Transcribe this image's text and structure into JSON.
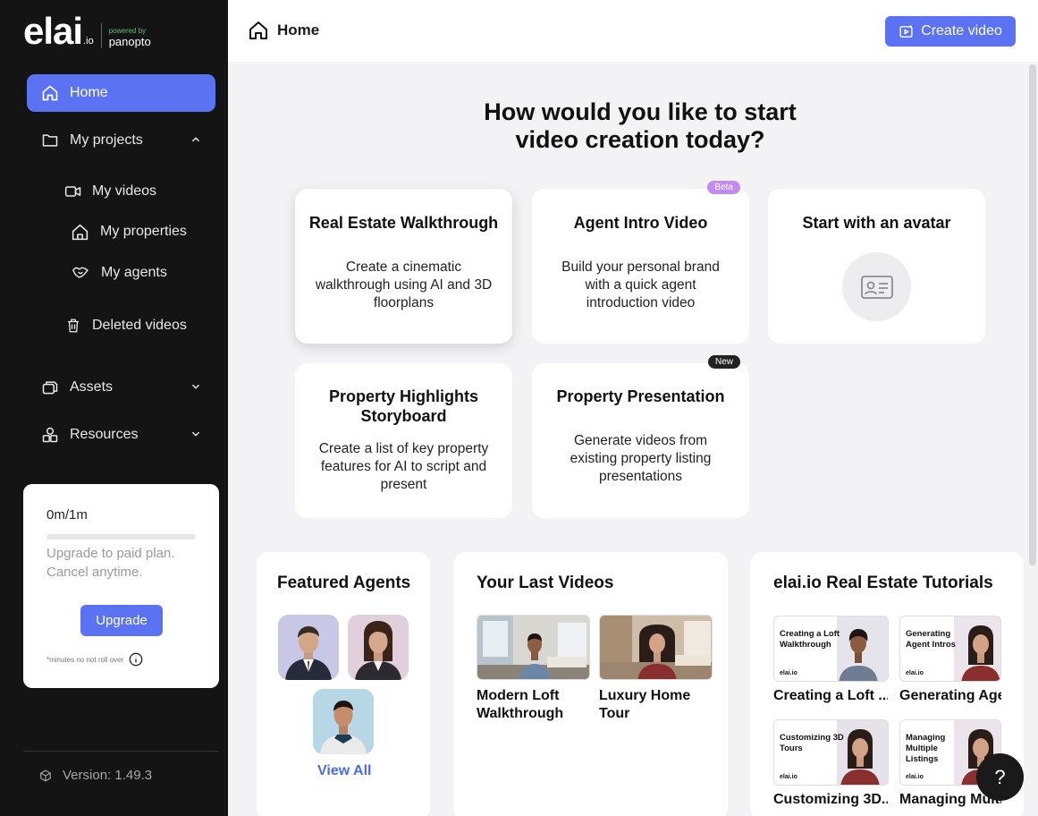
{
  "brand": {
    "logo_main": "elai",
    "logo_io": ".io",
    "powered_by": "powered by",
    "partner": "panopto"
  },
  "sidebar": {
    "home": "Home",
    "my_projects": "My projects",
    "my_videos": "My videos",
    "my_properties": "My properties",
    "my_agents": "My agents",
    "deleted_videos": "Deleted videos",
    "assets": "Assets",
    "resources": "Resources",
    "plan": {
      "usage": "0m/1m",
      "usage_fraction": 0,
      "message": "Upgrade to paid plan. Cancel anytime.",
      "upgrade_label": "Upgrade",
      "note": "*minutes no not roll over"
    },
    "version": "Version: 1.49.3"
  },
  "header": {
    "title": "Home",
    "create_label": "Create video"
  },
  "main": {
    "title": "How would you like to start video creation today?",
    "options": [
      {
        "title": "Real Estate Walkthrough",
        "desc": "Create a cinematic walkthrough using AI and 3D floorplans"
      },
      {
        "title": "Agent Intro Video",
        "desc": "Build your personal brand with a quick agent introduction video",
        "badge": "Beta"
      },
      {
        "title": "Start with an avatar"
      },
      {
        "title": "Property Highlights Storyboard",
        "desc": "Create a list of key property features for AI to script and present"
      },
      {
        "title": "Property Presentation",
        "desc": "Generate videos from existing property listing presentations",
        "badge": "New"
      }
    ]
  },
  "featured_agents": {
    "title": "Featured Agents",
    "view_all": "View All"
  },
  "last_videos": {
    "title": "Your Last Videos",
    "items": [
      {
        "label": "Modern Loft Walkthrough"
      },
      {
        "label": "Luxury Home Tour"
      }
    ]
  },
  "tutorials": {
    "title": "elai.io Real Estate Tutorials",
    "thumb_logo": "elai.io",
    "items": [
      {
        "thumb_text": "Creating a Loft Walkthrough",
        "label": "Creating a Loft ..."
      },
      {
        "thumb_text": "Generating Agent Intros",
        "label": "Generating Age"
      },
      {
        "thumb_text": "Customizing 3D Tours",
        "label": "Customizing 3D..."
      },
      {
        "thumb_text": "Managing Multiple Listings",
        "label": "Managing Multi"
      }
    ]
  },
  "help": {
    "label": "?"
  },
  "colors": {
    "accent": "#5b72f2",
    "sidebar_bg": "#141414",
    "beta_badge": "#c38bf0",
    "link": "#4a6bea"
  }
}
